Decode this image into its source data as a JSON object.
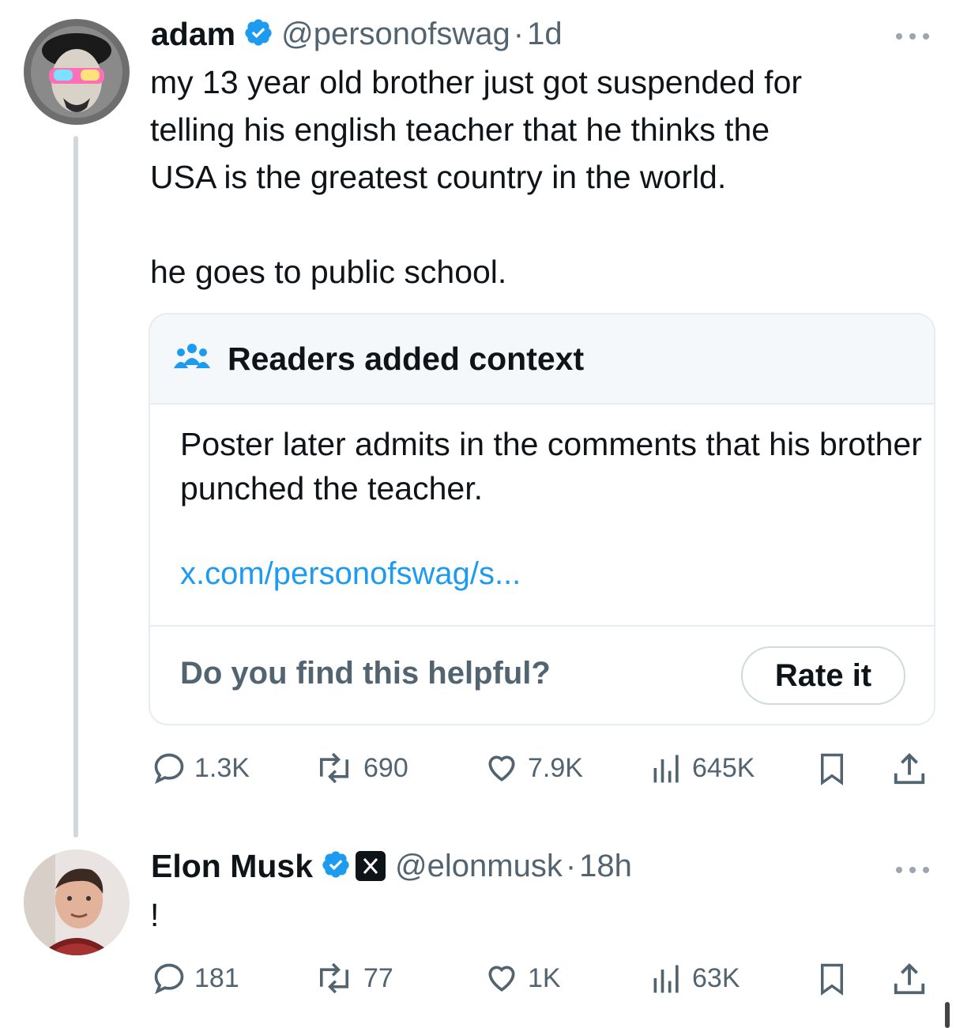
{
  "tweet1": {
    "name": "adam",
    "handle": "@personofswag",
    "separator": "·",
    "time": "1d",
    "text": "my 13 year old brother just got suspended for\ntelling his english teacher that he thinks the\nUSA is the greatest country in the world.\n\nhe goes to public school.",
    "note": {
      "title": "Readers added context",
      "body": "Poster later admits in the comments that his brother punched the teacher.",
      "link": "x.com/personofswag/s...",
      "question": "Do you find this helpful?",
      "rate_label": "Rate it"
    },
    "actions": {
      "replies": "1.3K",
      "reposts": "690",
      "likes": "7.9K",
      "views": "645K"
    }
  },
  "tweet2": {
    "name": "Elon Musk",
    "handle": "@elonmusk",
    "separator": "·",
    "time": "18h",
    "text": "!",
    "actions": {
      "replies": "181",
      "reposts": "77",
      "likes": "1K",
      "views": "63K"
    }
  },
  "colors": {
    "accent": "#1d9bf0",
    "text": "#0f1419",
    "muted": "#536471",
    "border": "#e6ecf0"
  },
  "icons": [
    "more-icon",
    "verified-icon",
    "readers-icon",
    "reply-icon",
    "repost-icon",
    "like-icon",
    "views-icon",
    "bookmark-icon",
    "share-icon",
    "x-logo-icon"
  ]
}
